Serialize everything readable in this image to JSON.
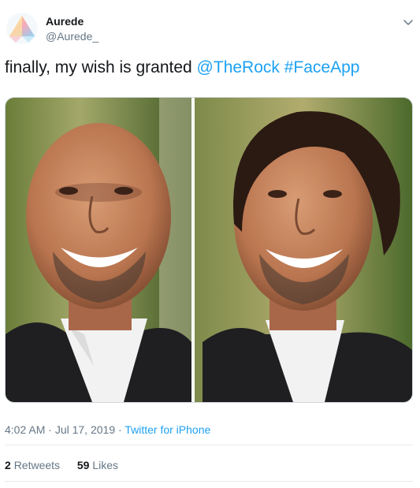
{
  "user": {
    "name": "Aurede",
    "handle": "@Aurede_"
  },
  "tweet": {
    "text": "finally, my wish is granted",
    "mention": "@TheRock",
    "hashtag": "#FaceApp"
  },
  "meta": {
    "time": "4:02 AM",
    "sep1": " · ",
    "date": "Jul 17, 2019",
    "sep2": " · ",
    "source": "Twitter for iPhone"
  },
  "stats": {
    "retweets_count": "2",
    "retweets_label": "Retweets",
    "likes_count": "59",
    "likes_label": "Likes"
  },
  "icons": {
    "menu": "chevron-down-icon",
    "avatar": "gradient-triangle-avatar"
  },
  "colors": {
    "link": "#1da1f2",
    "secondary": "#657786",
    "divider": "#e6ecf0"
  }
}
